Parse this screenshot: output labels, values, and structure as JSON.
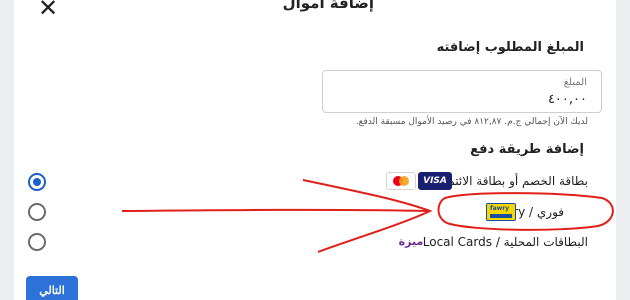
{
  "dialog": {
    "title": "إضافة أموال",
    "close_glyph": "✕",
    "amount_heading": "المبلغ المطلوب إضافته",
    "amount_field": {
      "label": "المبلغ",
      "value": "٤٠٠,٠٠"
    },
    "balance_note": "لديك الآن إجمالي ج.م. ٨١٢,٨٧ في رصيد الأموال مسبقة الدفع.",
    "payment_heading": "إضافة طريقة دفع",
    "payment_options": [
      {
        "label": "بطاقة الخصم أو بطاقة الائتمان",
        "selected": true,
        "icons": [
          "visa-icon",
          "mastercard-icon"
        ],
        "visa_text": "VISA"
      },
      {
        "label": "فوري / Fawry",
        "selected": false,
        "icons": [
          "fawry-icon"
        ],
        "logo_text": "fawry"
      },
      {
        "label": "البطاقات المحلية / Local Cards",
        "selected": false,
        "icons": [
          "meeza-icon"
        ],
        "logo_text": "ميزة"
      }
    ],
    "next_button": "التالي"
  },
  "colors": {
    "accent": "#2d72d9",
    "radio_selected": "#1a5fd0",
    "annotation": "#e0201b",
    "fawry_yellow": "#f5d600",
    "visa_blue": "#1a1f71"
  }
}
